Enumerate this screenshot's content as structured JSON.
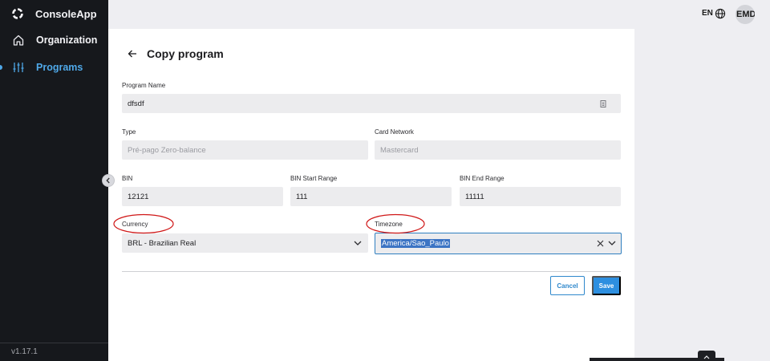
{
  "app": {
    "name": "ConsoleApp",
    "version": "v1.17.1"
  },
  "sidebar": {
    "items": [
      {
        "label": "Organization",
        "icon": "home-icon",
        "active": false
      },
      {
        "label": "Programs",
        "icon": "sliders-icon",
        "active": true
      }
    ]
  },
  "topbar": {
    "language": "EN",
    "avatar_initials": "EMD"
  },
  "page": {
    "title": "Copy program"
  },
  "form": {
    "program_name": {
      "label": "Program Name",
      "value": "dfsdf"
    },
    "type": {
      "label": "Type",
      "value": "Pré-pago Zero-balance"
    },
    "card_network": {
      "label": "Card Network",
      "value": "Mastercard"
    },
    "bin": {
      "label": "BIN",
      "value": "12121"
    },
    "bin_start": {
      "label": "BIN Start Range",
      "value": "111"
    },
    "bin_end": {
      "label": "BIN End Range",
      "value": "11111"
    },
    "currency": {
      "label": "Currency",
      "value": "BRL - Brazilian Real"
    },
    "timezone": {
      "label": "Timezone",
      "value": "America/Sao_Paulo"
    }
  },
  "actions": {
    "cancel": "Cancel",
    "save": "Save"
  },
  "colors": {
    "accent": "#2d8fe0",
    "sidebar_bg": "#16181c",
    "active_nav": "#4fa8e8",
    "annotation": "#d01818"
  }
}
